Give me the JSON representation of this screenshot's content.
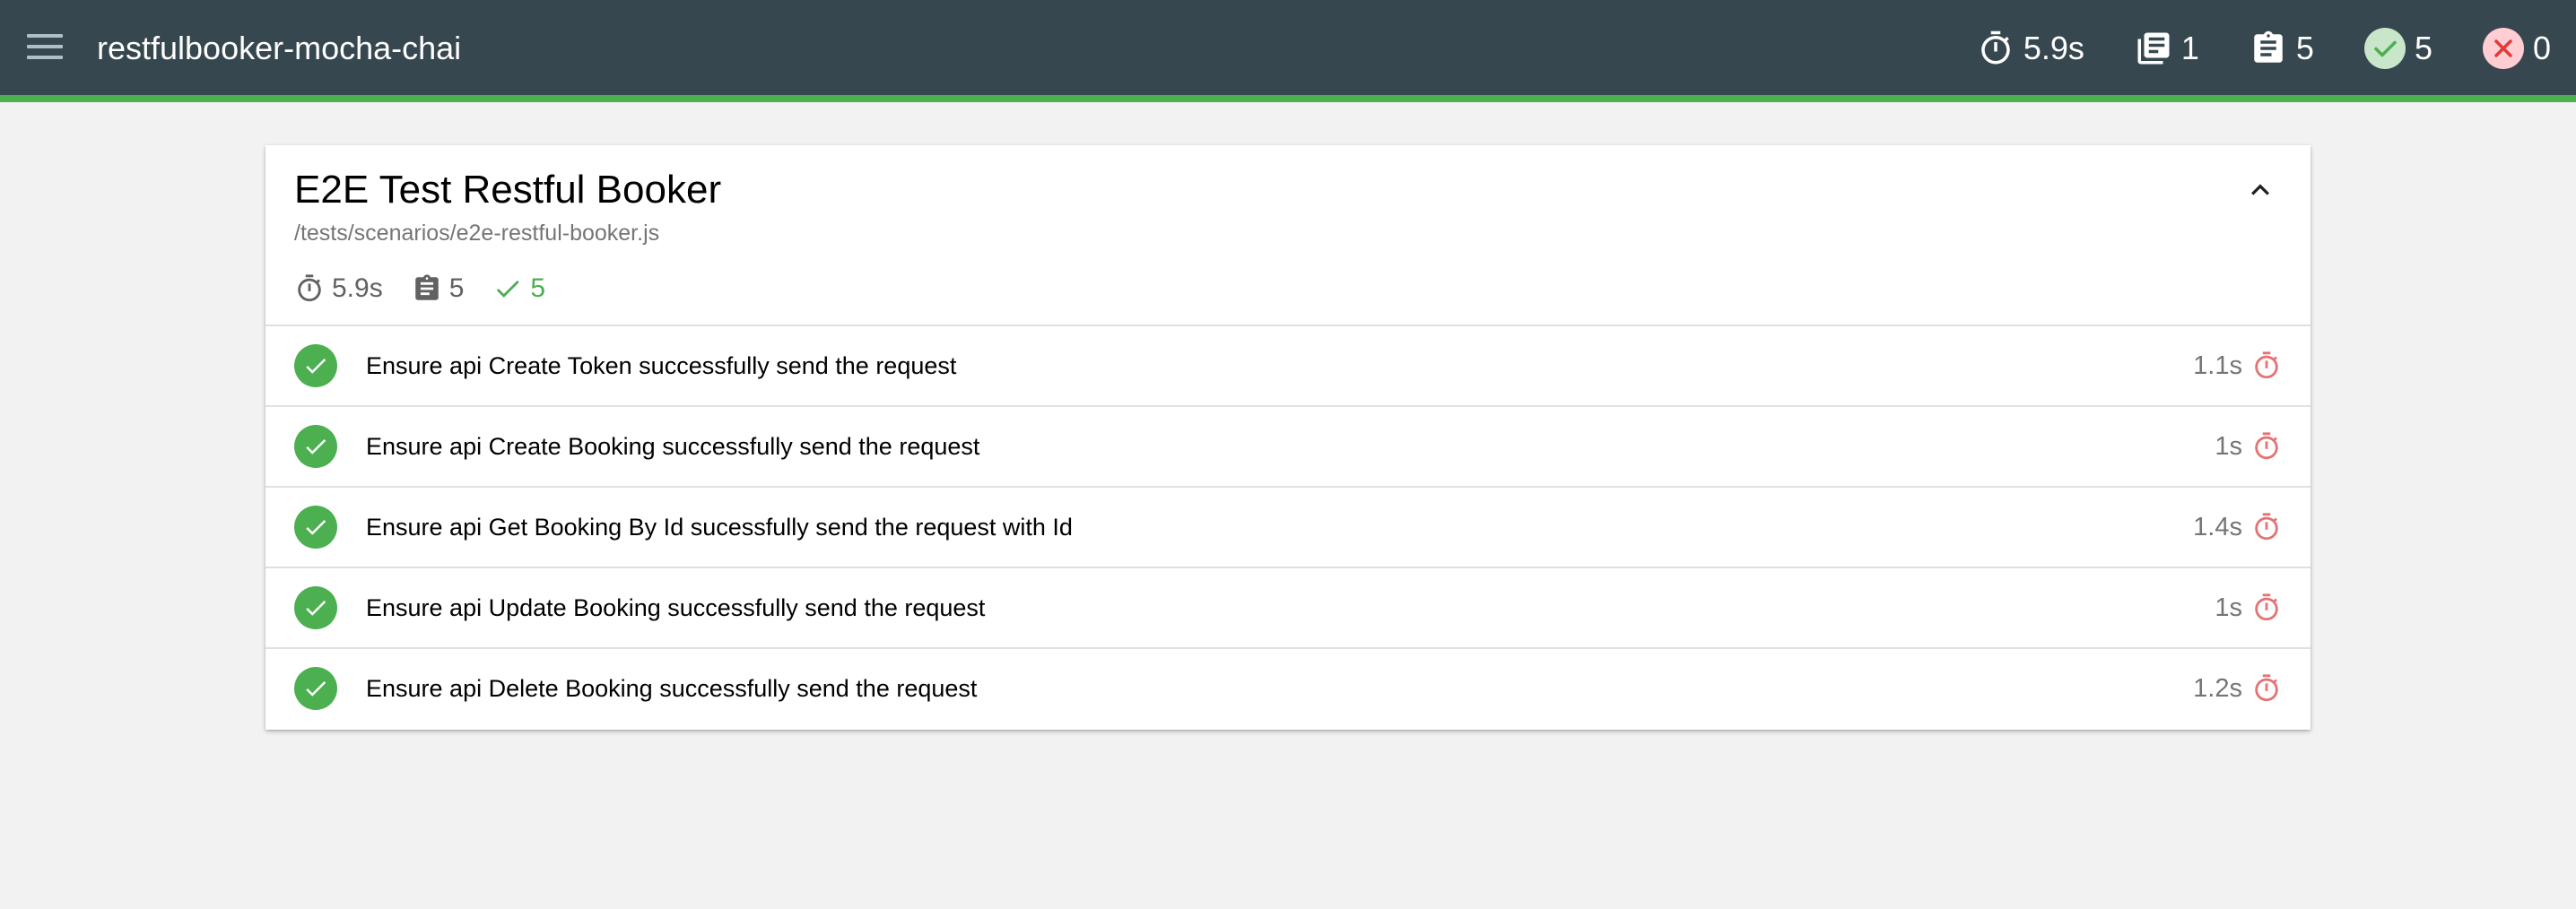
{
  "navbar": {
    "title": "restfulbooker-mocha-chai",
    "stats": {
      "duration": "5.9s",
      "suites": "1",
      "tests": "5",
      "passes": "5",
      "failures": "0"
    }
  },
  "suite": {
    "title": "E2E Test Restful Booker",
    "file": "/tests/scenarios/e2e-restful-booker.js",
    "summary": {
      "duration": "5.9s",
      "tests": "5",
      "passes": "5"
    },
    "tests": [
      {
        "title": "Ensure api Create Token successfully send the request",
        "duration": "1.1s",
        "state": "passed"
      },
      {
        "title": "Ensure api Create Booking successfully send the request",
        "duration": "1s",
        "state": "passed"
      },
      {
        "title": "Ensure api Get Booking By Id sucessfully send the request with Id",
        "duration": "1.4s",
        "state": "passed"
      },
      {
        "title": "Ensure api Update Booking successfully send the request",
        "duration": "1s",
        "state": "passed"
      },
      {
        "title": "Ensure api Delete Booking successfully send the request",
        "duration": "1.2s",
        "state": "passed"
      }
    ]
  },
  "icons": {
    "menu": "menu-icon",
    "timer": "timer-icon",
    "suites": "library-books-icon",
    "tests": "assignment-icon",
    "passed": "check-circle-icon",
    "failed": "cancel-icon",
    "collapse": "chevron-up-icon"
  },
  "colors": {
    "navbar": "#37474f",
    "accent_bar": "#4caf50",
    "pass": "#4caf50",
    "fail": "#e57373",
    "pass_badge_bg": "#c8e6c9",
    "fail_badge_bg": "#ffcdd2",
    "background": "#f2f2f2"
  }
}
